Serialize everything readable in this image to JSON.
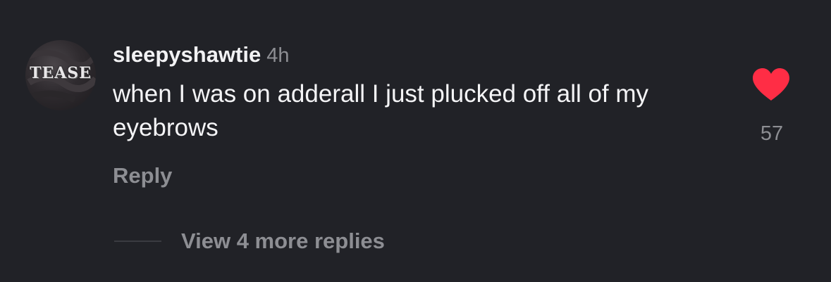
{
  "comment": {
    "avatar_text": "TEASE",
    "username": "sleepyshawtie",
    "time": "4h",
    "text": "when I was on adderall I just plucked off all of my eyebrows",
    "reply_label": "Reply",
    "like_icon": "heart-icon",
    "like_color": "#ff2d45",
    "like_count": "57"
  },
  "replies": {
    "view_more_label": "View 4 more replies"
  },
  "colors": {
    "background": "#212227",
    "primary_text": "#f4f4f6",
    "secondary_text": "#8d8e93"
  }
}
